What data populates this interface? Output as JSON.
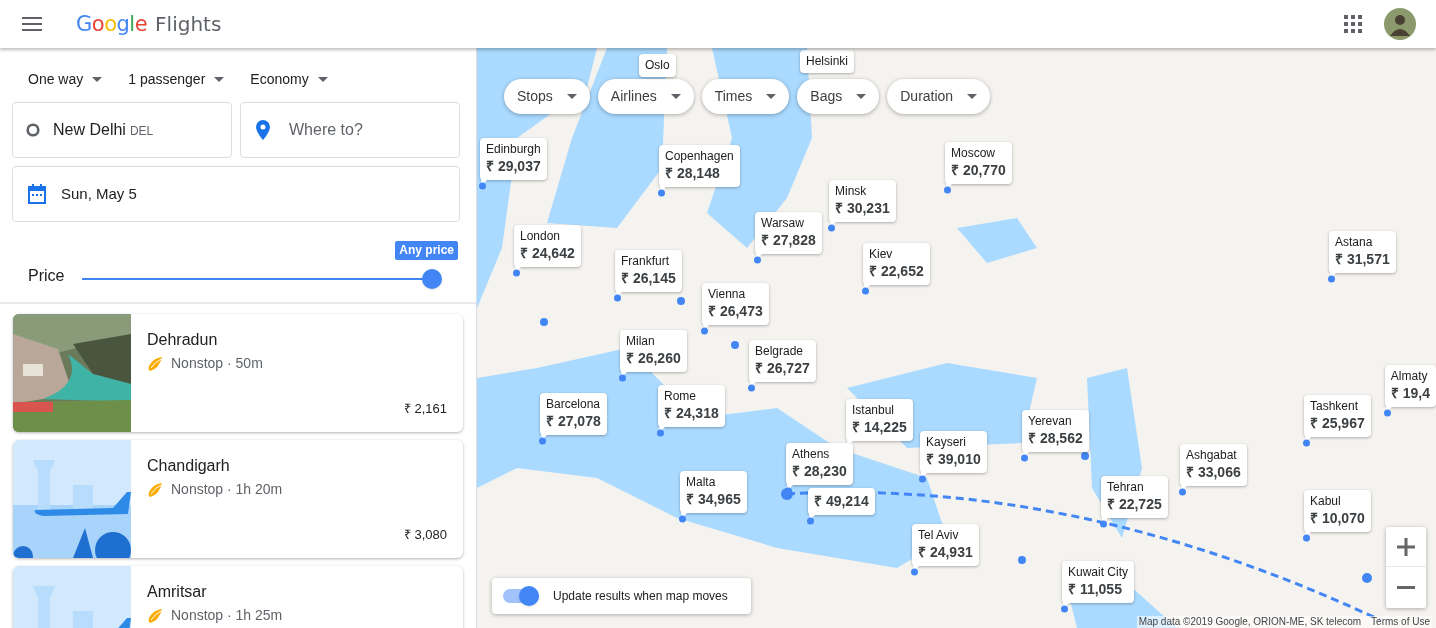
{
  "header": {
    "logo": "Google",
    "product": "Flights"
  },
  "search": {
    "trip_type": "One way",
    "passengers": "1 passenger",
    "cabin": "Economy",
    "origin": {
      "city": "New Delhi",
      "code": "DEL"
    },
    "destination": {
      "placeholder": "Where to?"
    },
    "date": "Sun, May 5",
    "price_filter": {
      "label": "Price",
      "tooltip": "Any price",
      "level": 1
    }
  },
  "results": [
    {
      "city": "Dehradun",
      "details": "Nonstop · 50m",
      "price": "₹ 2,161"
    },
    {
      "kind": "illustration",
      "city": "Chandigarh",
      "details": "Nonstop · 1h 20m",
      "price": "₹ 3,080"
    },
    {
      "kind": "illustration",
      "city": "Amritsar",
      "details": "Nonstop · 1h 25m"
    }
  ],
  "map": {
    "filters": [
      "Stops",
      "Airlines",
      "Times",
      "Bags",
      "Duration"
    ],
    "pins": [
      {
        "city": "Oslo"
      },
      {
        "city": "Helsinki"
      },
      {
        "city": "Edinburgh",
        "price": "₹ 29,037"
      },
      {
        "city": "Copenhagen",
        "price": "₹ 28,148"
      },
      {
        "city": "Moscow",
        "price": "₹ 20,770"
      },
      {
        "city": "Minsk",
        "price": "₹ 30,231"
      },
      {
        "city": "London",
        "price": "₹ 24,642"
      },
      {
        "city": "Frankfurt",
        "price": "₹ 26,145"
      },
      {
        "city": "Warsaw",
        "price": "₹ 27,828"
      },
      {
        "city": "Kiev",
        "price": "₹ 22,652"
      },
      {
        "city": "Astana",
        "price": "₹ 31,571"
      },
      {
        "city": "Vienna",
        "price": "₹ 26,473"
      },
      {
        "city": "Milan",
        "price": "₹ 26,260"
      },
      {
        "city": "Belgrade",
        "price": "₹ 26,727"
      },
      {
        "city": "Almaty",
        "price": "₹ 19,4"
      },
      {
        "city": "Barcelona",
        "price": "₹ 27,078"
      },
      {
        "city": "Rome",
        "price": "₹ 24,318"
      },
      {
        "city": "Istanbul",
        "price": "₹ 14,225"
      },
      {
        "city": "Yerevan",
        "price": "₹ 28,562"
      },
      {
        "city": "Tashkent",
        "price": "₹ 25,967"
      },
      {
        "city": "Athens",
        "price": "₹ 28,230"
      },
      {
        "city": "Kayseri",
        "price": "₹ 39,010"
      },
      {
        "city": "Ashgabat",
        "price": "₹ 33,066"
      },
      {
        "city": "Malta",
        "price": "₹ 34,965"
      },
      {
        "price": "₹ 49,214"
      },
      {
        "city": "Tehran",
        "price": "₹ 22,725"
      },
      {
        "city": "Kabul",
        "price": "₹ 10,070"
      },
      {
        "city": "Tel Aviv",
        "price": "₹ 24,931"
      },
      {
        "city": "Kuwait City",
        "price": "₹ 11,055"
      }
    ],
    "update_toggle": {
      "label": "Update results when map moves",
      "on": true
    },
    "attribution": "Map data ©2019 Google, ORION-ME, SK telecom",
    "terms": "Terms of Use"
  }
}
